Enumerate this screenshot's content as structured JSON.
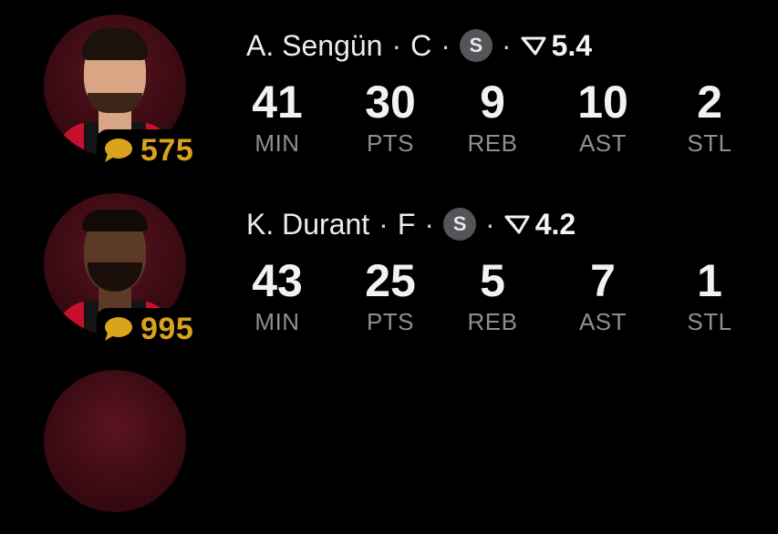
{
  "players": [
    {
      "name": "A. Sengün",
      "position": "C",
      "badge": "S",
      "projection": "5.4",
      "comments": "575",
      "stats": [
        {
          "value": "41",
          "label": "MIN"
        },
        {
          "value": "30",
          "label": "PTS"
        },
        {
          "value": "9",
          "label": "REB"
        },
        {
          "value": "10",
          "label": "AST"
        },
        {
          "value": "2",
          "label": "STL"
        }
      ]
    },
    {
      "name": "K. Durant",
      "position": "F",
      "badge": "S",
      "projection": "4.2",
      "comments": "995",
      "stats": [
        {
          "value": "43",
          "label": "MIN"
        },
        {
          "value": "25",
          "label": "PTS"
        },
        {
          "value": "5",
          "label": "REB"
        },
        {
          "value": "7",
          "label": "AST"
        },
        {
          "value": "1",
          "label": "STL"
        }
      ]
    }
  ],
  "separator": "·",
  "icons": {
    "comment": "speech-bubble-icon",
    "projection": "triangle-filter-icon"
  },
  "colors": {
    "background": "#000000",
    "comment_accent": "#d9a31c",
    "stat_label": "#8e8e93",
    "badge": "#555559",
    "team_red": "#c8102e"
  }
}
